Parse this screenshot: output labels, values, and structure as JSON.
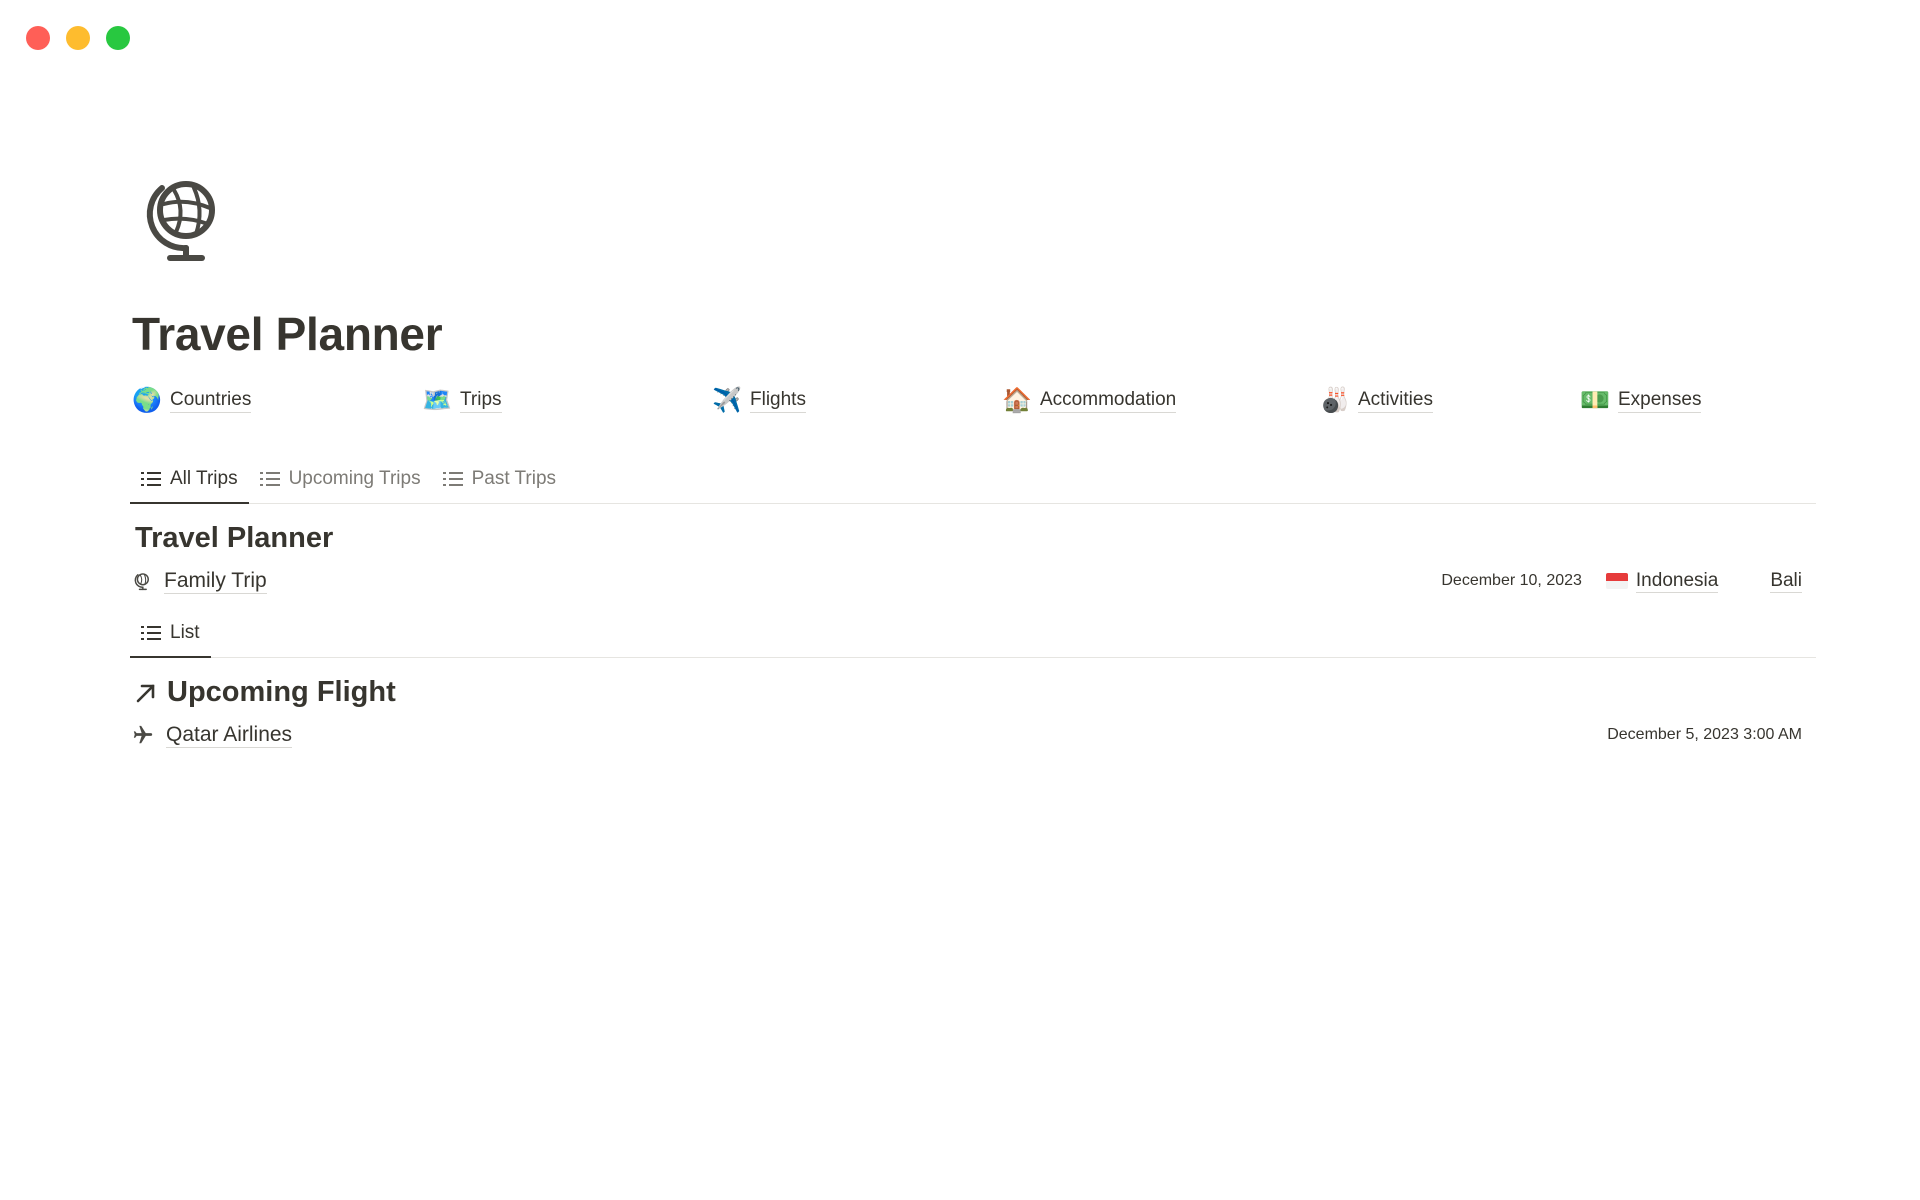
{
  "window": {
    "controls": {
      "close_color": "#ff5f57",
      "minimize_color": "#febc2e",
      "zoom_color": "#28c840"
    }
  },
  "page": {
    "icon": "globe-icon",
    "title": "Travel Planner"
  },
  "links": [
    {
      "label": "Countries",
      "icon": "🌍"
    },
    {
      "label": "Trips",
      "icon": "🗺️"
    },
    {
      "label": "Flights",
      "icon": "✈️"
    },
    {
      "label": "Accommodation",
      "icon": "🏠"
    },
    {
      "label": "Activities",
      "icon": "🎳"
    },
    {
      "label": "Expenses",
      "icon": "💵"
    }
  ],
  "trip_tabs": [
    {
      "label": "All Trips",
      "active": true
    },
    {
      "label": "Upcoming Trips",
      "active": false
    },
    {
      "label": "Past Trips",
      "active": false
    }
  ],
  "trips_section": {
    "title": "Travel Planner",
    "rows": [
      {
        "name": "Family Trip",
        "date": "December 10, 2023",
        "country": "Indonesia",
        "city": "Bali"
      }
    ]
  },
  "flight_tabs": [
    {
      "label": "List",
      "active": true
    }
  ],
  "flight_section": {
    "title": "Upcoming Flight",
    "rows": [
      {
        "name": "Qatar Airlines",
        "datetime": "December 5, 2023 3:00 AM"
      }
    ]
  }
}
